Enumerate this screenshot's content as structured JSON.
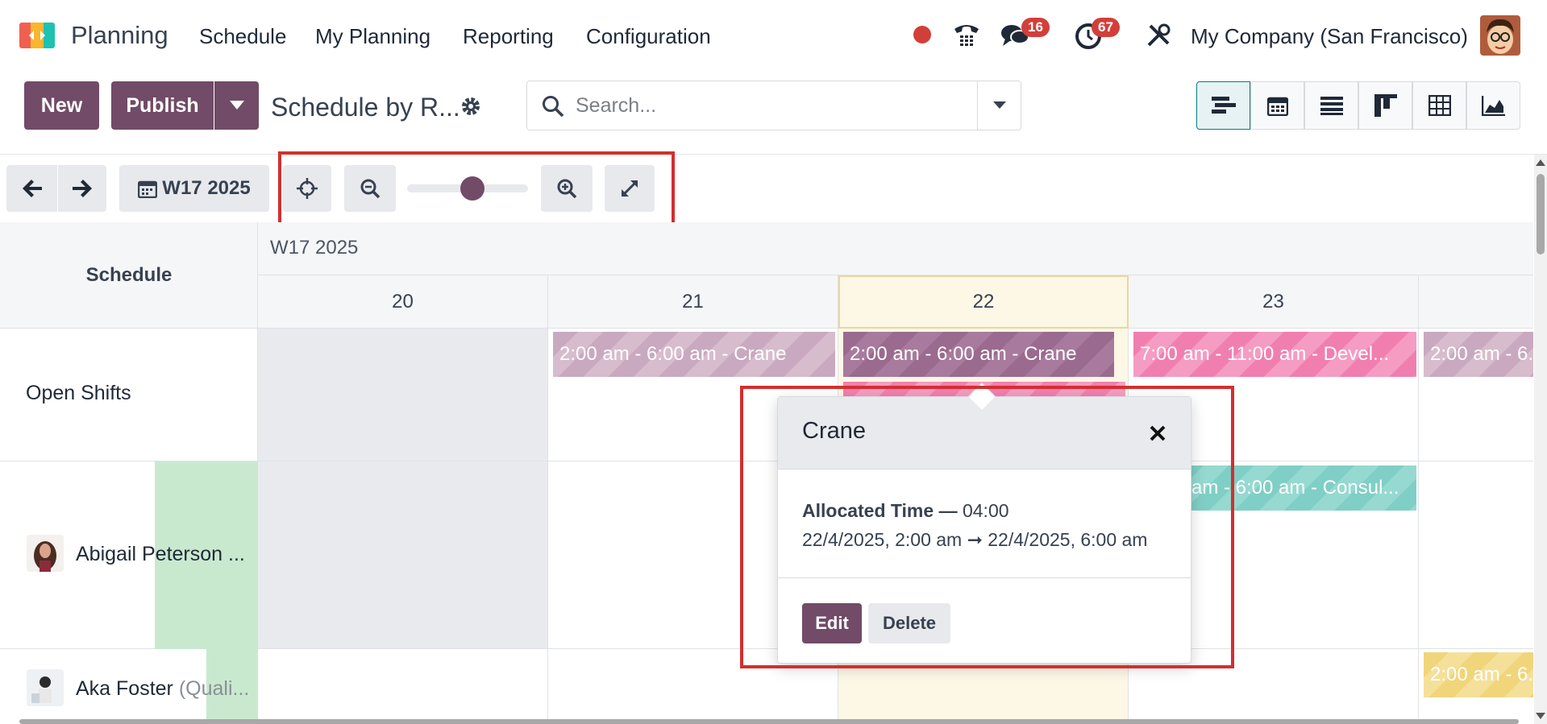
{
  "navbar": {
    "app_name": "Planning",
    "menu": [
      "Schedule",
      "My Planning",
      "Reporting",
      "Configuration"
    ],
    "messages_count": "16",
    "activities_count": "67",
    "company": "My Company (San Francisco)"
  },
  "control_panel": {
    "new_label": "New",
    "publish_label": "Publish",
    "view_title": "Schedule by R...",
    "search_placeholder": "Search...",
    "views": [
      "gantt-icon",
      "calendar-icon",
      "list-icon",
      "kanban-icon",
      "pivot-icon",
      "graph-icon"
    ]
  },
  "gantt_toolbar": {
    "period_label": "W17 2025",
    "zoom_level": 0.55
  },
  "gantt": {
    "header_title": "Schedule",
    "week_label": "W17 2025",
    "days": [
      "20",
      "21",
      "22",
      "23"
    ],
    "rows": [
      {
        "label": "Open Shifts"
      },
      {
        "label": "Abigail Peterson ..."
      },
      {
        "label": "Aka Foster",
        "sub": "(Quali..."
      }
    ],
    "pills": [
      {
        "text": "2:00 am - 6:00 am - Crane"
      },
      {
        "text": "2:00 am - 6:00 am - Crane"
      },
      {
        "text": "7:00 am - 11:00 am - Devel..."
      },
      {
        "text": "2:00 am - 6..."
      },
      {
        "text": "am - 6:00 am - Consul..."
      },
      {
        "text": "2:00 am - 6..."
      }
    ]
  },
  "popover": {
    "title": "Crane",
    "allocated_label": "Allocated Time —",
    "allocated_value": "04:00",
    "dates": "22/4/2025, 2:00 am ➞ 22/4/2025, 6:00 am",
    "edit_label": "Edit",
    "delete_label": "Delete"
  }
}
